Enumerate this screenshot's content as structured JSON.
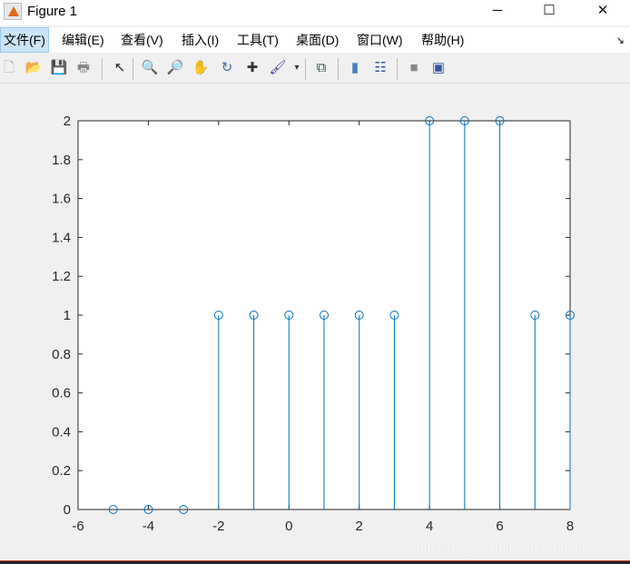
{
  "window": {
    "title": "Figure 1",
    "minimize": "─",
    "maximize": "☐",
    "close": "✕"
  },
  "menu": [
    {
      "label": "文件(F)"
    },
    {
      "label": "编辑(E)"
    },
    {
      "label": "查看(V)"
    },
    {
      "label": "插入(I)"
    },
    {
      "label": "工具(T)"
    },
    {
      "label": "桌面(D)"
    },
    {
      "label": "窗口(W)"
    },
    {
      "label": "帮助(H)"
    }
  ],
  "dock_icon": "↘",
  "toolbar": [
    {
      "name": "new-figure-icon",
      "glyph": "🗋"
    },
    {
      "name": "open-file-icon",
      "glyph": "📂"
    },
    {
      "name": "save-icon",
      "glyph": "💾"
    },
    {
      "name": "print-icon",
      "glyph": "🖶"
    },
    {
      "name": "pointer-icon",
      "glyph": "↖"
    },
    {
      "name": "zoom-in-icon",
      "glyph": "🔍"
    },
    {
      "name": "zoom-out-icon",
      "glyph": "🔎"
    },
    {
      "name": "pan-icon",
      "glyph": "✋"
    },
    {
      "name": "rotate-icon",
      "glyph": "↻"
    },
    {
      "name": "data-cursor-icon",
      "glyph": "✚"
    },
    {
      "name": "brush-icon",
      "glyph": "🖌"
    },
    {
      "name": "brush-dropdown-icon",
      "glyph": "▾"
    },
    {
      "name": "link-plot-icon",
      "glyph": "⧉"
    },
    {
      "name": "colorbar-icon",
      "glyph": "▮"
    },
    {
      "name": "legend-icon",
      "glyph": "☷"
    },
    {
      "name": "hide-plot-tools-icon",
      "glyph": "■"
    },
    {
      "name": "show-plot-tools-icon",
      "glyph": "▣"
    }
  ],
  "watermark": "https://blog.csdn.net/haichao666",
  "colors": {
    "stem": "#0072BD"
  },
  "chart_data": {
    "type": "stem",
    "x": [
      -5,
      -4,
      -3,
      -2,
      -1,
      0,
      1,
      2,
      3,
      4,
      5,
      6,
      7,
      8
    ],
    "y": [
      0,
      0,
      0,
      1,
      1,
      1,
      1,
      1,
      1,
      2,
      2,
      2,
      1,
      1
    ],
    "xlim": [
      -6,
      8
    ],
    "ylim": [
      0,
      2
    ],
    "xticks": [
      "-6",
      "-4",
      "-2",
      "0",
      "2",
      "4",
      "6",
      "8"
    ],
    "yticks": [
      "0",
      "0.2",
      "0.4",
      "0.6",
      "0.8",
      "1",
      "1.2",
      "1.4",
      "1.6",
      "1.8",
      "2"
    ],
    "title": "",
    "xlabel": "",
    "ylabel": ""
  }
}
